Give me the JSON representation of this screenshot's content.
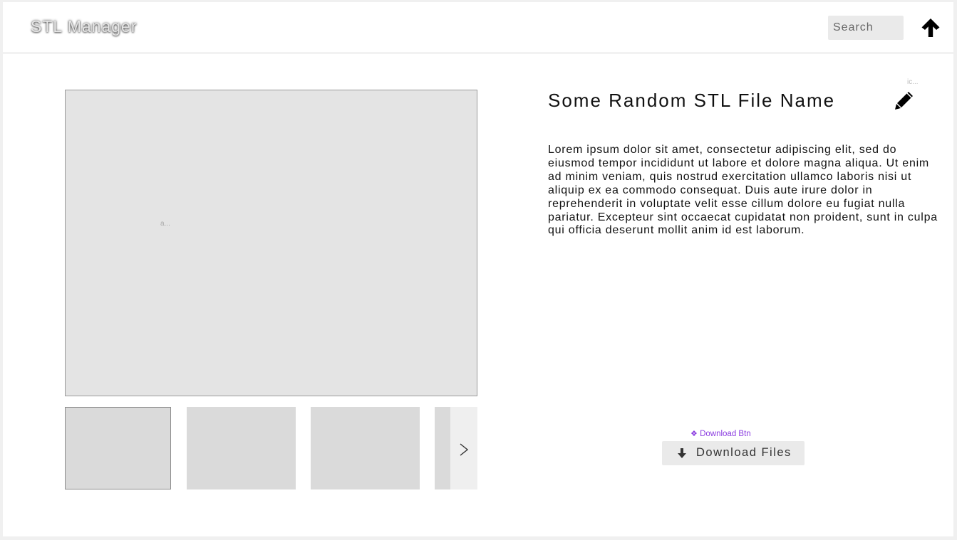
{
  "header": {
    "app_title": "STL Manager",
    "search_placeholder": "Search",
    "upload_icon": "arrow-up-icon"
  },
  "gallery": {
    "main_image_alt": "a...",
    "thumbnails": [
      {
        "selected": true
      },
      {
        "selected": false
      },
      {
        "selected": false
      },
      {
        "selected": false
      }
    ],
    "next_icon": "chevron-right-icon"
  },
  "details": {
    "icon_hint": "ic...",
    "title": "Some Random STL File Name",
    "edit_icon": "pencil-icon",
    "description": "Lorem ipsum dolor sit amet, consectetur adipiscing elit, sed do eiusmod tempor incididunt ut labore et dolore magna aliqua. Ut enim ad minim veniam, quis nostrud exercitation ullamco laboris nisi ut aliquip ex ea commodo consequat. Duis aute irure dolor in reprehenderit in voluptate velit esse cillum dolore eu fugiat nulla pariatur. Excepteur sint occaecat cupidatat non proident, sunt in culpa qui officia deserunt mollit anim id est laborum."
  },
  "download": {
    "component_label": "Download Btn",
    "button_label": "Download Files",
    "icon": "arrow-down-icon"
  },
  "colors": {
    "component_label": "#8a3be0",
    "button_bg": "#eaeaea",
    "image_placeholder": "#e4e4e4",
    "thumbnail_placeholder": "#dadada"
  }
}
